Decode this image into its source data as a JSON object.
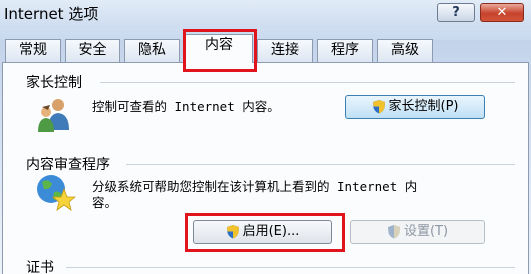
{
  "window": {
    "title": "Internet 选项",
    "help_label": "?",
    "close_label": "✕"
  },
  "tabs": [
    {
      "label": "常规",
      "active": false
    },
    {
      "label": "安全",
      "active": false
    },
    {
      "label": "隐私",
      "active": false
    },
    {
      "label": "内容",
      "active": true
    },
    {
      "label": "连接",
      "active": false
    },
    {
      "label": "程序",
      "active": false
    },
    {
      "label": "高级",
      "active": false
    }
  ],
  "parental": {
    "group_label": "家长控制",
    "description": "控制可查看的 Internet 内容。",
    "button_label": "家长控制(P)",
    "icon": "family-users-icon"
  },
  "advisor": {
    "group_label": "内容审查程序",
    "description_line1": "分级系统可帮助您控制在该计算机上看到的 Internet 内",
    "description_line2": "容。",
    "enable_label": "启用(E)...",
    "settings_label": "设置(T)",
    "icon": "globe-star-icon"
  },
  "certificates": {
    "group_label": "证书"
  },
  "colors": {
    "highlight": "#e0141c",
    "accent": "#3c7fb1"
  }
}
